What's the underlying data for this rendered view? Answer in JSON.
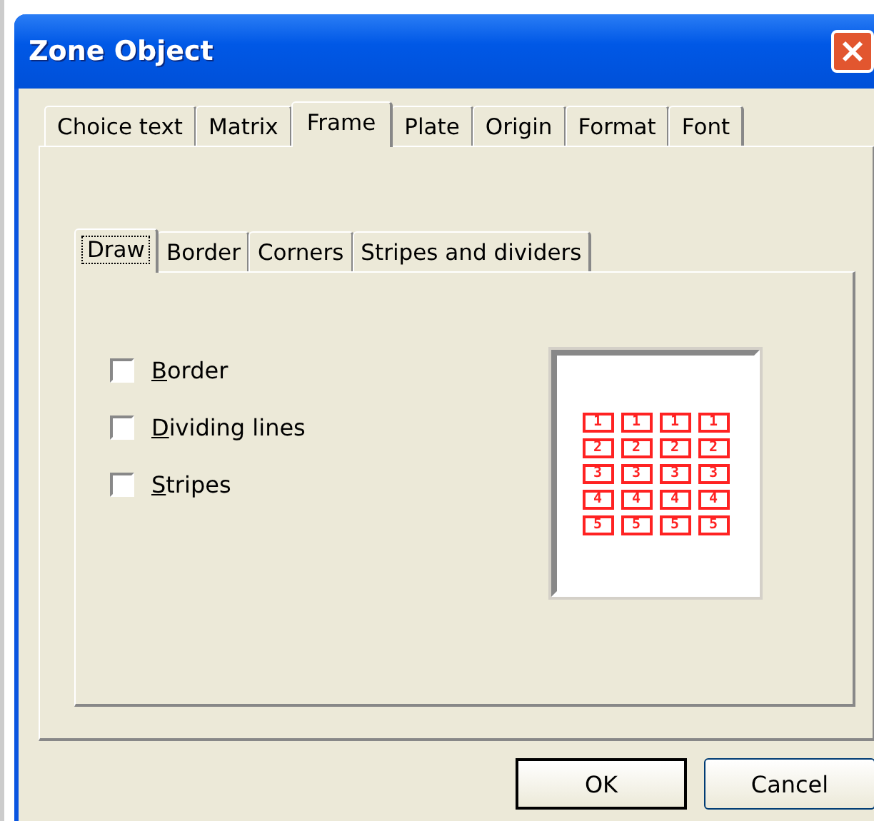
{
  "window": {
    "title": "Zone Object"
  },
  "tabs": [
    {
      "label": "Choice text",
      "selected": false
    },
    {
      "label": "Matrix",
      "selected": false
    },
    {
      "label": "Frame",
      "selected": true
    },
    {
      "label": "Plate",
      "selected": false
    },
    {
      "label": "Origin",
      "selected": false
    },
    {
      "label": "Format",
      "selected": false
    },
    {
      "label": "Font",
      "selected": false
    }
  ],
  "subtabs": [
    {
      "label": "Draw",
      "selected": true
    },
    {
      "label": "Border",
      "selected": false
    },
    {
      "label": "Corners",
      "selected": false
    },
    {
      "label": "Stripes and dividers",
      "selected": false
    }
  ],
  "options": [
    {
      "label": "Border",
      "checked": false
    },
    {
      "label": "Dividing lines",
      "checked": false
    },
    {
      "label": "Stripes",
      "checked": false
    }
  ],
  "preview": {
    "rows": [
      [
        "1",
        "1",
        "1",
        "1"
      ],
      [
        "2",
        "2",
        "2",
        "2"
      ],
      [
        "3",
        "3",
        "3",
        "3"
      ],
      [
        "4",
        "4",
        "4",
        "4"
      ],
      [
        "5",
        "5",
        "5",
        "5"
      ]
    ]
  },
  "buttons": [
    {
      "label": "OK",
      "default": true
    },
    {
      "label": "Cancel",
      "default": false
    }
  ]
}
